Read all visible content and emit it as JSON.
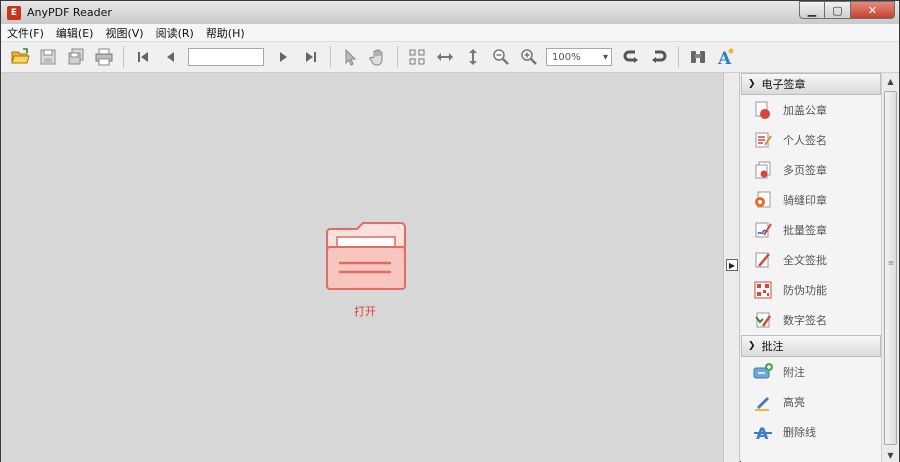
{
  "window": {
    "title": "AnyPDF Reader",
    "app_icon_letter": "E"
  },
  "menu": [
    {
      "label": "文件(F)"
    },
    {
      "label": "编辑(E)"
    },
    {
      "label": "视图(V)"
    },
    {
      "label": "阅读(R)"
    },
    {
      "label": "帮助(H)"
    }
  ],
  "toolbar": {
    "page_value": "",
    "zoom_value": "100%",
    "icons": [
      "open-folder-icon",
      "save-icon",
      "save-as-icon",
      "print-icon",
      "first-page-icon",
      "prev-page-icon",
      "next-page-icon",
      "last-page-icon",
      "select-icon",
      "hand-icon",
      "fit-page-icon",
      "fit-width-icon",
      "fit-height-icon",
      "zoom-out-icon",
      "zoom-in-icon",
      "rotate-left-icon",
      "rotate-right-icon",
      "find-icon",
      "text-icon"
    ]
  },
  "document": {
    "open_label": "打开"
  },
  "panel": {
    "sections": [
      {
        "title": "电子签章",
        "items": [
          {
            "label": "加盖公章",
            "icon": "stamp-icon"
          },
          {
            "label": "个人签名",
            "icon": "signature-icon"
          },
          {
            "label": "多页签章",
            "icon": "multi-page-icon"
          },
          {
            "label": "骑缝印章",
            "icon": "seam-seal-icon"
          },
          {
            "label": "批量签章",
            "icon": "batch-sign-icon"
          },
          {
            "label": "全文签批",
            "icon": "pen-icon"
          },
          {
            "label": "防伪功能",
            "icon": "qr-icon"
          },
          {
            "label": "数字签名",
            "icon": "digital-sign-icon"
          }
        ]
      },
      {
        "title": "批注",
        "items": [
          {
            "label": "附注",
            "icon": "note-icon"
          },
          {
            "label": "高亮",
            "icon": "highlight-icon"
          },
          {
            "label": "删除线",
            "icon": "strikeout-icon"
          }
        ]
      }
    ]
  },
  "colors": {
    "accent": "#d9453a",
    "doc_bg": "#d7d7d7"
  }
}
